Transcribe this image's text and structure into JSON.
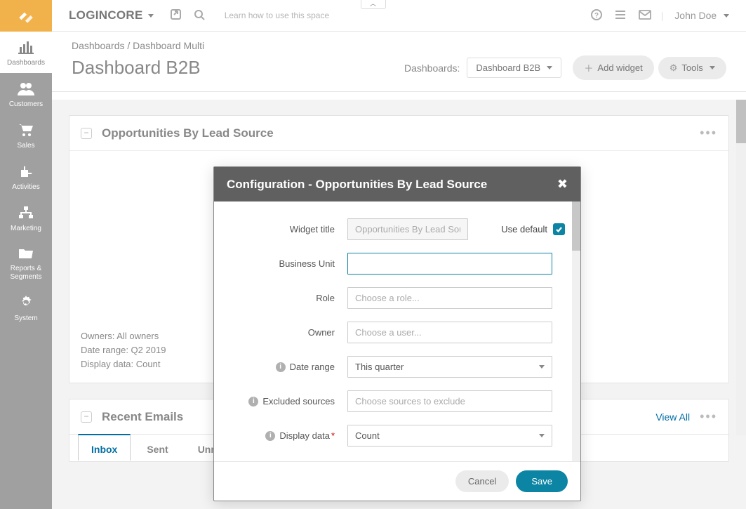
{
  "brand": "LOGINCORE",
  "top_hint": "Learn how to use this space",
  "user_name": "John Doe",
  "sidebar": {
    "items": [
      {
        "label": "Dashboards"
      },
      {
        "label": "Customers"
      },
      {
        "label": "Sales"
      },
      {
        "label": "Activities"
      },
      {
        "label": "Marketing"
      },
      {
        "label": "Reports & Segments"
      },
      {
        "label": "System"
      }
    ]
  },
  "breadcrumb": {
    "a": "Dashboards",
    "b": "Dashboard Multi"
  },
  "page_title": "Dashboard B2B",
  "head": {
    "dash_label": "Dashboards:",
    "dash_value": "Dashboard B2B",
    "add_widget": "Add widget",
    "tools": "Tools"
  },
  "panel1": {
    "title": "Opportunities By Lead Source",
    "meta": {
      "l1": "Owners: All owners",
      "l2": "Date range: Q2 2019",
      "l3": "Display data: Count"
    }
  },
  "panel2": {
    "title": "Recent Emails",
    "viewall": "View All",
    "tabs": [
      "Inbox",
      "Sent",
      "Unread Emails"
    ]
  },
  "modal": {
    "title": "Configuration - Opportunities By Lead Source",
    "labels": {
      "widget_title": "Widget title",
      "use_default": "Use default",
      "business_unit": "Business Unit",
      "role": "Role",
      "owner": "Owner",
      "date_range": "Date range",
      "excluded": "Excluded sources",
      "display_data": "Display data"
    },
    "placeholders": {
      "widget_title": "Opportunities By Lead Source",
      "role": "Choose a role...",
      "owner": "Choose a user...",
      "excluded": "Choose sources to exclude"
    },
    "values": {
      "date_range": "This quarter",
      "display_data": "Count"
    },
    "use_default_checked": true,
    "buttons": {
      "cancel": "Cancel",
      "save": "Save"
    }
  },
  "colors": {
    "accent": "#0c84a3",
    "orange": "#f1b14b"
  }
}
